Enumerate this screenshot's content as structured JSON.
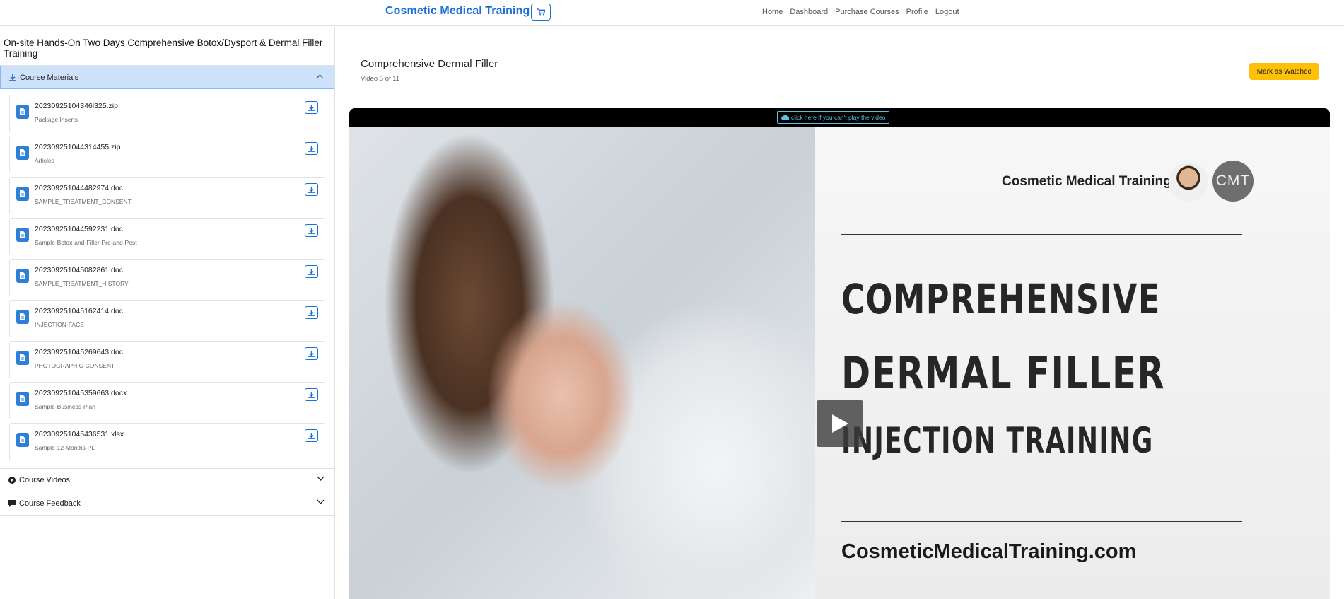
{
  "navbar": {
    "brand": "Cosmetic Medical Training",
    "links": [
      "Home",
      "Dashboard",
      "Purchase Courses",
      "Profile",
      "Logout"
    ]
  },
  "sidebar": {
    "course_title": "On-site Hands-On Two Days Comprehensive Botox/Dysport & Dermal Filler Training",
    "sections": {
      "materials": "Course Materials",
      "videos": "Course Videos",
      "feedback": "Course Feedback"
    },
    "files": [
      {
        "name": "20230925104346l325.zip",
        "desc": "Package Inserts"
      },
      {
        "name": "202309251044314455.zip",
        "desc": "Articles"
      },
      {
        "name": "202309251044482974.doc",
        "desc": "SAMPLE_TREATMENT_CONSENT"
      },
      {
        "name": "202309251044592231.doc",
        "desc": "Sample-Botox-and-Filler-Pre-and-Post"
      },
      {
        "name": "202309251045082861.doc",
        "desc": "SAMPLE_TREATMENT_HISTORY"
      },
      {
        "name": "202309251045162414.doc",
        "desc": "INJECTION-FACE"
      },
      {
        "name": "202309251045269643.doc",
        "desc": "PHOTOGRAPHIC-CONSENT"
      },
      {
        "name": "202309251045359663.docx",
        "desc": "Sample-Business-Plan"
      },
      {
        "name": "202309251045436531.xlsx",
        "desc": "Sample-12-Months-PL"
      }
    ]
  },
  "main": {
    "video_title": "Comprehensive Dermal Filler",
    "video_count": "Video 5 of 11",
    "mark_button": "Mark as Watched",
    "cant_play": "click here if you can't play the video",
    "slide": {
      "brand": "Cosmetic Medical Training",
      "logo": "CMT",
      "line1": "COMPREHENSIVE",
      "line2": "DERMAL FILLER",
      "line3": "INJECTION TRAINING",
      "url": "CosmeticMedicalTraining.com"
    }
  },
  "colors": {
    "brand": "#1a6fd8",
    "accent": "#ffc107",
    "info": "#5bc0de"
  }
}
